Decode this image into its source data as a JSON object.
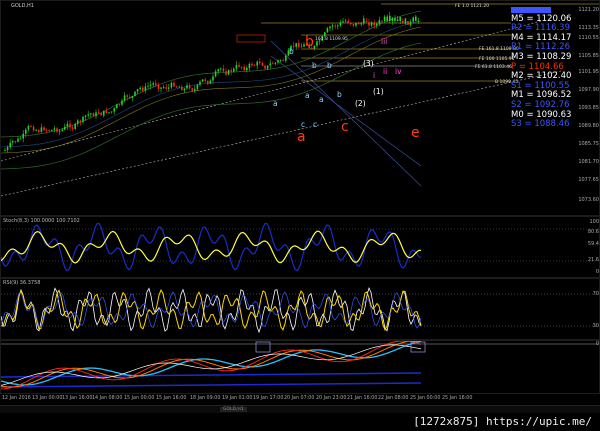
{
  "symbol": "GOLD,H1",
  "colors": {
    "red": "#ff2a00",
    "blue": "#3b55ff",
    "white": "#ffffff",
    "gold": "#e0c030",
    "yellow": "#ffff40",
    "navy": "#1b2bd0"
  },
  "levels": [
    {
      "label": "",
      "value": "",
      "color": "#3b55ff",
      "icon": "blue-level-marker"
    },
    {
      "label": "M5 = 1120.06",
      "color": "#ffffff"
    },
    {
      "label": "R2 = 1116.39",
      "color": "#3b55ff"
    },
    {
      "label": "M4 = 1114.17",
      "color": "#ffffff"
    },
    {
      "label": "R1 = 1112.26",
      "color": "#3b55ff"
    },
    {
      "label": "M3 = 1108.29",
      "color": "#ffffff"
    },
    {
      "label": "P = 1104.66",
      "color": "#ff2a00"
    },
    {
      "label": "M2 = 1102.40",
      "color": "#ffffff"
    },
    {
      "label": "S1 = 1100.55",
      "color": "#3b55ff"
    },
    {
      "label": "M1 = 1096.52",
      "color": "#ffffff"
    },
    {
      "label": "S2 = 1092.76",
      "color": "#3b55ff"
    },
    {
      "label": "M0 = 1090.63",
      "color": "#ffffff"
    },
    {
      "label": "S3 = 1088.46",
      "color": "#3b55ff"
    }
  ],
  "wave_labels": {
    "a": "a",
    "b": "b",
    "c": "c",
    "e": "e"
  },
  "small_labels": [
    "a",
    "b",
    "c",
    "b",
    "c",
    "a",
    "b",
    "a",
    "b",
    "(3)",
    "(2)",
    "(1)",
    "iii",
    "ii",
    "iv",
    "i"
  ],
  "fib_tags": [
    "FE 161.8 1109.80",
    "FE 100 1105.91",
    "FE 61.8 1103.46",
    "B 1099.45",
    "FE 1.0 1121.20",
    "161.8 1109.95"
  ],
  "price_axis": [
    "1121.20",
    "1113.35",
    "1110.55",
    "1105.85",
    "1101.95",
    "1097.90",
    "1093.85",
    "1089.80",
    "1085.75",
    "1081.70",
    "1077.65",
    "1073.60"
  ],
  "stoch": {
    "label": "Stoch(8,3) 100.0000 100.7102",
    "axis": [
      "100",
      "80.6",
      "59.4",
      "21.6",
      "0"
    ]
  },
  "rsi": {
    "label": "RSI(9) 36.3758",
    "axis": [
      "70",
      "30"
    ]
  },
  "macd": {
    "axis": [
      "0"
    ]
  },
  "time_axis": [
    "12 Jan 2016",
    "13 Jan 00:00",
    "13 Jan 16:00",
    "14 Jan 08:00",
    "15 Jan 00:00",
    "15 Jan 16:00",
    "18 Jan 09:00",
    "19 Jan 01:00",
    "19 Jan 17:00",
    "20 Jan 07:00",
    "20 Jan 23:00",
    "21 Jan 16:00",
    "22 Jan 08:00",
    "25 Jan 00:00",
    "25 Jan 16:00"
  ],
  "tabs": [
    "GOLD,H1"
  ],
  "caption": "[1272x875] https://upic.me/"
}
